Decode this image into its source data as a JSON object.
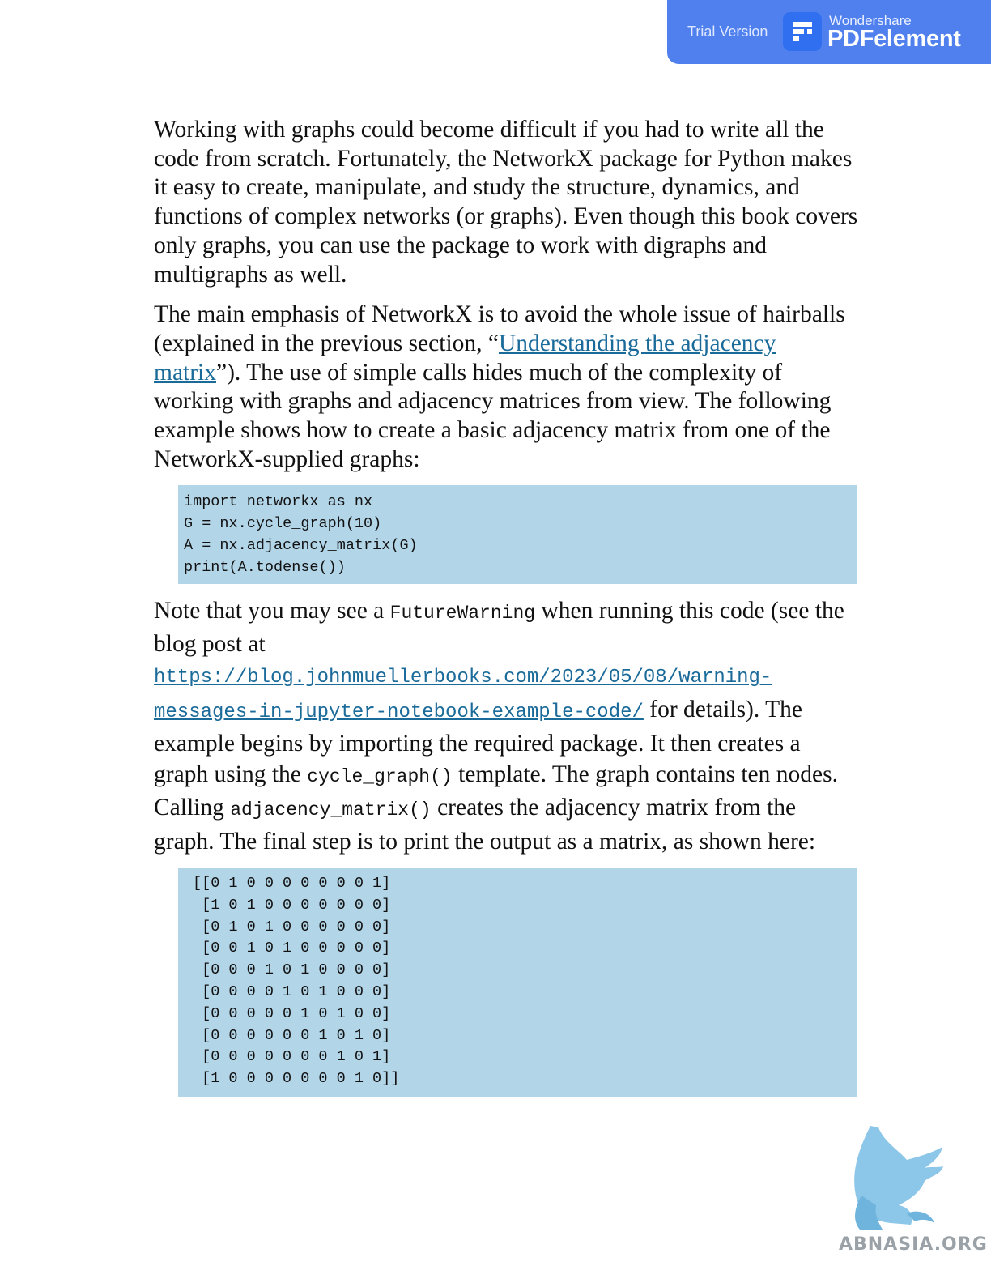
{
  "banner": {
    "trial_label": "Trial Version",
    "brand_small": "Wondershare",
    "brand_big": "PDFelement"
  },
  "para1": "Working with graphs could become difficult if you had to write all the code from scratch. Fortunately, the NetworkX package for Python makes it easy to create, manipulate, and study the structure, dynamics, and functions of complex networks (or graphs). Even though this book covers only graphs, you can use the package to work with digraphs and multigraphs as well.",
  "para2": {
    "before_link": "The main emphasis of NetworkX is to avoid the whole issue of hairballs (explained in the previous section, “",
    "link": "Understanding the adjacency matrix",
    "after_link": "”). The use of simple calls hides much of the complexity of working with graphs and adjacency matrices from view. The following example shows how to create a basic adjacency matrix from one of the NetworkX-supplied graphs:"
  },
  "code1": [
    "import networkx as nx",
    "G = nx.cycle_graph(10)",
    "A = nx.adjacency_matrix(G)",
    "print(A.todense())"
  ],
  "para3": {
    "t1": "Note that you may see a ",
    "c1": "FutureWarning",
    "t2": " when running this code (see the blog post at ",
    "url": "https://blog.johnmuellerbooks.com/2023/05/08/warning-messages-in-jupyter-notebook-example-code/",
    "t3": " for details). The example begins by importing the required package. It then creates a graph using the ",
    "c2": "cycle_graph()",
    "t4": " template. The graph contains ten nodes. Calling ",
    "c3": "adjacency_matrix()",
    "t5": " creates the adjacency matrix from the graph. The final step is to print the output as a matrix, as shown here:"
  },
  "matrix_output": [
    "[[0 1 0 0 0 0 0 0 0 1]",
    " [1 0 1 0 0 0 0 0 0 0]",
    " [0 1 0 1 0 0 0 0 0 0]",
    " [0 0 1 0 1 0 0 0 0 0]",
    " [0 0 0 1 0 1 0 0 0 0]",
    " [0 0 0 0 1 0 1 0 0 0]",
    " [0 0 0 0 0 1 0 1 0 0]",
    " [0 0 0 0 0 0 1 0 1 0]",
    " [0 0 0 0 0 0 0 1 0 1]",
    " [1 0 0 0 0 0 0 0 1 0]]"
  ],
  "watermark": {
    "text": "ABNASIA.ORG",
    "icon": "griffin-logo-icon"
  },
  "colors": {
    "banner": "#4f80ee",
    "code_bg": "#b3d5e8",
    "link": "#1a6a9a"
  }
}
